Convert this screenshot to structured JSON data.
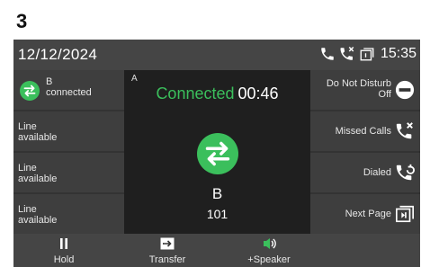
{
  "figure_number": "3",
  "status_bar": {
    "date": "12/12/2024",
    "time": "15:35",
    "icons": [
      "phone-icon",
      "missed-call-icon",
      "voicemail-icon"
    ]
  },
  "line_keys": [
    {
      "line1": "B",
      "line2": "connected",
      "icon": "transfer-icon",
      "active": true
    },
    {
      "line1": "Line",
      "line2": "available",
      "active": false
    },
    {
      "line1": "Line",
      "line2": "available",
      "active": false
    },
    {
      "line1": "Line",
      "line2": "available",
      "active": false
    }
  ],
  "call": {
    "line_letter": "A",
    "state": "Connected",
    "timer": "00:46",
    "name": "B",
    "number": "101",
    "icon": "transfer-icon"
  },
  "right_keys": [
    {
      "line1": "Do Not Disturb",
      "line2": "Off",
      "icon": "dnd-icon"
    },
    {
      "line1": "Missed Calls",
      "line2": "",
      "icon": "missed-call-icon"
    },
    {
      "line1": "Dialed",
      "line2": "",
      "icon": "dialed-icon"
    },
    {
      "line1": "Next Page",
      "line2": "",
      "icon": "next-page-icon"
    }
  ],
  "softkeys": [
    {
      "label": "Hold",
      "icon": "pause-icon"
    },
    {
      "label": "Transfer",
      "icon": "transfer-key-icon"
    },
    {
      "label": "+Speaker",
      "icon": "speaker-icon"
    }
  ],
  "colors": {
    "accent_green": "#3bbf5c",
    "background": "#333333",
    "bar": "#454545"
  }
}
